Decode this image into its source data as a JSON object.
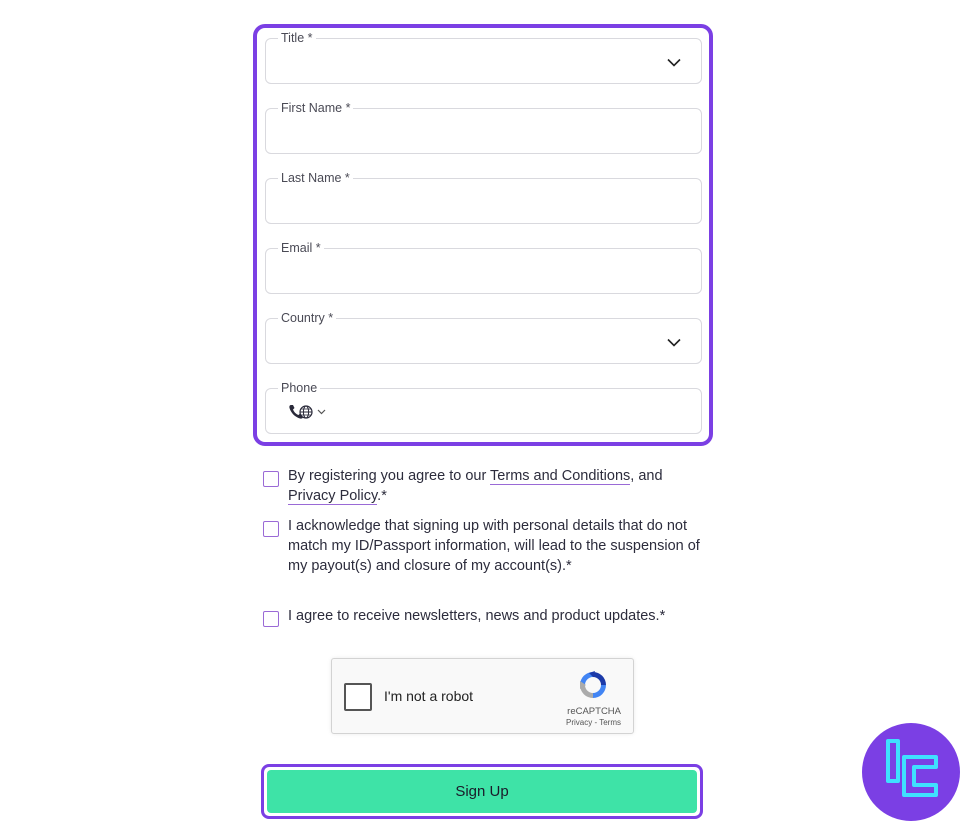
{
  "form": {
    "fields": [
      {
        "label": "Title *",
        "value": "",
        "type": "select"
      },
      {
        "label": "First Name *",
        "value": "",
        "type": "text"
      },
      {
        "label": "Last Name *",
        "value": "",
        "type": "text"
      },
      {
        "label": "Email *",
        "value": "",
        "type": "text"
      },
      {
        "label": "Country *",
        "value": "",
        "type": "select"
      },
      {
        "label": "Phone",
        "value": "",
        "type": "phone",
        "prefix_icon": "phone-globe-icon"
      }
    ]
  },
  "consents": [
    {
      "text_before": "By registering you agree to our ",
      "link1": "Terms and Conditions",
      "text_mid": ", and ",
      "link2": "Privacy Policy",
      "text_after": ".*",
      "checked": false
    },
    {
      "text": "I acknowledge that signing up with personal details that do not match my ID/Passport information, will lead to the suspension of my payout(s) and closure of my account(s).*",
      "checked": false
    },
    {
      "text": "I agree to receive newsletters, news and product updates.*",
      "checked": false
    }
  ],
  "recaptcha": {
    "label": "I'm not a robot",
    "brand": "reCAPTCHA",
    "privacy": "Privacy",
    "separator": " - ",
    "terms": "Terms",
    "checked": false
  },
  "signup": {
    "label": "Sign Up"
  },
  "colors": {
    "accent": "#7b3fe4",
    "button": "#3ee3a7",
    "checkbox_border": "#9a6ad6"
  }
}
